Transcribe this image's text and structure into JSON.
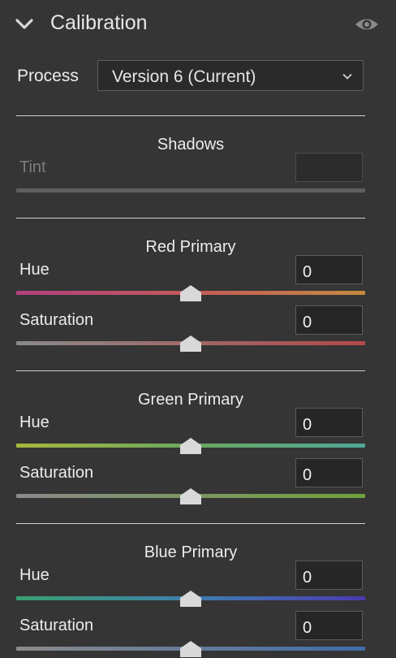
{
  "panel": {
    "title": "Calibration",
    "process_label": "Process",
    "process_value": "Version 6 (Current)"
  },
  "shadows": {
    "title": "Shadows",
    "tint_label": "Tint",
    "tint_value": ""
  },
  "red_primary": {
    "title": "Red Primary",
    "hue_label": "Hue",
    "hue_value": "0",
    "saturation_label": "Saturation",
    "saturation_value": "0"
  },
  "green_primary": {
    "title": "Green Primary",
    "hue_label": "Hue",
    "hue_value": "0",
    "saturation_label": "Saturation",
    "saturation_value": "0"
  },
  "blue_primary": {
    "title": "Blue Primary",
    "hue_label": "Hue",
    "hue_value": "0",
    "saturation_label": "Saturation",
    "saturation_value": "0"
  },
  "icons": {
    "collapse": "chevron-down-icon",
    "visibility": "eye-icon",
    "dropdown": "chevron-down-icon"
  },
  "colors": {
    "background": "#353535",
    "divider": "#cfcfcf",
    "red_hue_gradient": [
      "#b0407f",
      "#c45a5a",
      "#c58a40"
    ],
    "red_saturation_gradient": [
      "#8a8a8a",
      "#b44848"
    ],
    "green_hue_gradient": [
      "#a8b83c",
      "#6aa860",
      "#4fa898"
    ],
    "green_saturation_gradient": [
      "#8a8a8a",
      "#6ea23a"
    ],
    "blue_hue_gradient": [
      "#3aa070",
      "#3e7fae",
      "#4a3ab0"
    ],
    "blue_saturation_gradient": [
      "#8a8a8a",
      "#3f6ca8"
    ]
  }
}
